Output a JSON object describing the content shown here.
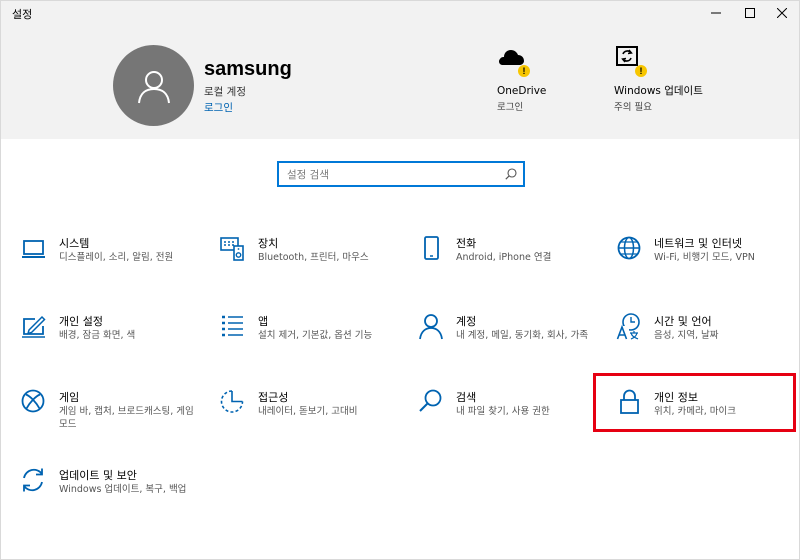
{
  "window": {
    "title": "설정",
    "controls": {
      "minimize": "minimize",
      "maximize": "maximize",
      "close": "close"
    }
  },
  "account": {
    "name": "samsung",
    "type": "로컬 계정",
    "login_link": "로그인"
  },
  "status": {
    "onedrive": {
      "title": "OneDrive",
      "subtitle": "로그인"
    },
    "update": {
      "title": "Windows 업데이트",
      "subtitle": "주의 필요"
    }
  },
  "search": {
    "placeholder": "설정 검색",
    "value": ""
  },
  "tiles": [
    {
      "title": "시스템",
      "desc": "디스플레이, 소리, 알림, 전원",
      "icon": "laptop-icon"
    },
    {
      "title": "장치",
      "desc": "Bluetooth, 프린터, 마우스",
      "icon": "keyboard-speaker-icon"
    },
    {
      "title": "전화",
      "desc": "Android, iPhone 연결",
      "icon": "phone-icon"
    },
    {
      "title": "네트워크 및 인터넷",
      "desc": "Wi-Fi, 비행기 모드, VPN",
      "icon": "globe-icon"
    },
    {
      "title": "개인 설정",
      "desc": "배경, 잠금 화면, 색",
      "icon": "pen-screen-icon"
    },
    {
      "title": "앱",
      "desc": "설치 제거, 기본값, 옵션 기능",
      "icon": "apps-list-icon"
    },
    {
      "title": "계정",
      "desc": "내 계정, 메일, 동기화, 회사, 가족",
      "icon": "person-icon"
    },
    {
      "title": "시간 및 언어",
      "desc": "음성, 지역, 날짜",
      "icon": "time-language-icon"
    },
    {
      "title": "게임",
      "desc": "게임 바, 캡처, 브로드캐스팅, 게임 모드",
      "icon": "xbox-icon"
    },
    {
      "title": "접근성",
      "desc": "내레이터, 돋보기, 고대비",
      "icon": "ease-of-access-icon"
    },
    {
      "title": "검색",
      "desc": "내 파일 찾기, 사용 권한",
      "icon": "magnifier-icon"
    },
    {
      "title": "개인 정보",
      "desc": "위치, 카메라, 마이크",
      "icon": "lock-icon"
    },
    {
      "title": "업데이트 및 보안",
      "desc": "Windows 업데이트, 복구, 백업",
      "icon": "sync-arrows-icon"
    }
  ],
  "colors": {
    "accent": "#0063b1",
    "highlight_box": "#e60012",
    "warning": "#f7c600",
    "header_bg": "#f2f2f2",
    "avatar_bg": "#767676"
  }
}
